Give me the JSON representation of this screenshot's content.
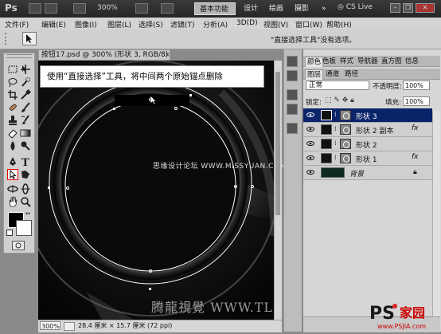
{
  "app": {
    "logo": "Ps",
    "zoom": "300%"
  },
  "workspace": {
    "basic": "基本功能",
    "design": "设计",
    "paint": "绘画",
    "photo": "摄影",
    "more": "»"
  },
  "cslive": "CS Live",
  "menu": {
    "items": [
      "文件(F)",
      "编辑(E)",
      "图像(I)",
      "图层(L)",
      "选择(S)",
      "滤镜(T)",
      "分析(A)",
      "3D(D)",
      "视图(V)",
      "窗口(W)",
      "帮助(H)"
    ]
  },
  "options": {
    "hint": "\"直接选择工具\"没有选项。"
  },
  "document": {
    "tab": "按钮17.psd @ 300% (形状 3, RGB/8) *",
    "close": "×",
    "zoom": "300%",
    "info": "28.4 厘米 × 15.7 厘米 (72 ppi)"
  },
  "annotation": "使用“直接选择”工具，将中间两个原始锚点删除",
  "watermark": {
    "center": "思缘设计论坛 WWW.MISSYUAN.COM",
    "bottom": "腾龍視覺 WWW.TL"
  },
  "panels": {
    "top_tabs": [
      "颜色",
      "色板",
      "样式",
      "导航器",
      "直方图",
      "信息"
    ],
    "layer_tabs": [
      "图层",
      "通道",
      "路径"
    ],
    "blend_mode": "正常",
    "opacity_label": "不透明度:",
    "opacity_value": "100%",
    "lock_label": "锁定:",
    "fill_label": "填充:",
    "fill_value": "100%",
    "layers": [
      {
        "name": "形状 3",
        "selected": true,
        "fx": ""
      },
      {
        "name": "形状 2 副本",
        "selected": false,
        "fx": "fx"
      },
      {
        "name": "形状 2",
        "selected": false,
        "fx": ""
      },
      {
        "name": "形状 1",
        "selected": false,
        "fx": "fx"
      },
      {
        "name": "背景",
        "selected": false,
        "fx": ""
      }
    ]
  },
  "brand": {
    "ps": "PS",
    "jia": "家园",
    "url": "www.PSJIA.com"
  },
  "colors": {
    "selected_layer": "#0a246a",
    "anchor": "#ffffff",
    "tool_highlight": "#e00000"
  }
}
